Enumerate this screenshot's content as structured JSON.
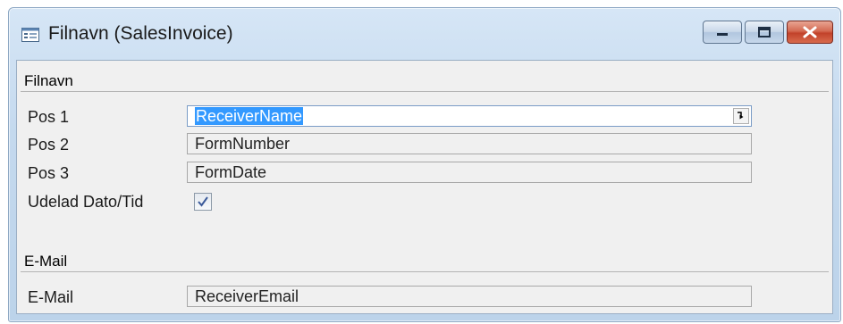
{
  "window": {
    "title": "Filnavn (SalesInvoice)",
    "icon": "form-icon",
    "buttons": {
      "minimize": "minimize-icon",
      "maximize": "maximize-icon",
      "close": "close-icon"
    }
  },
  "sections": {
    "filnavn": {
      "header": "Filnavn",
      "pos1_label": "Pos 1",
      "pos1_value": "ReceiverName",
      "pos2_label": "Pos 2",
      "pos2_value": "FormNumber",
      "pos3_label": "Pos 3",
      "pos3_value": "FormDate",
      "exclude_label": "Udelad Dato/Tid",
      "exclude_checked": true
    },
    "email": {
      "header": "E-Mail",
      "email_label": "E-Mail",
      "email_value": "ReceiverEmail"
    }
  },
  "colors": {
    "selection": "#3399ff",
    "close_button": "#c2422a",
    "title_bar": "#c4d9ee"
  }
}
